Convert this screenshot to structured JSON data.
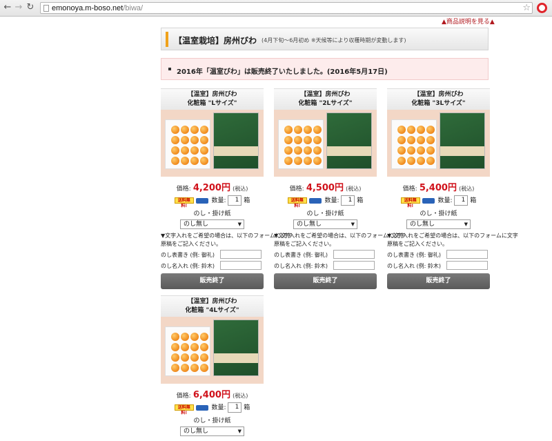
{
  "browser": {
    "url_host": "emonoya.m-boso.net",
    "url_path": "/biwa/"
  },
  "page": {
    "help_link": "▲商品説明を見る▲",
    "title": "【温室栽培】房州びわ",
    "subtitle": "(4月下旬〜6月初め ※天候等により収穫時期が変動します)",
    "notice": "2016年「温室びわ」は販売終了いたしました。(2016年5月17日)"
  },
  "common": {
    "price_label": "価格:",
    "tax_label": "(税込)",
    "free_shipping": "送料無料!",
    "qty_label": "数量:",
    "qty_value": "1",
    "qty_unit": "箱",
    "noshi_label": "のし・掛け紙",
    "noshi_selected": "のし無し",
    "help_text": "▼文字入れをご希望の場合は、以下のフォームに文字原稿をご記入ください。",
    "field1_label": "のし表書き (例: 御礼)",
    "field2_label": "のし名入れ (例: 鈴木)",
    "soldout_label": "販売終了"
  },
  "products": [
    {
      "line1": "【温室】房州びわ",
      "line2": "化粧箱 \"Lサイズ\"",
      "price": "4,200円"
    },
    {
      "line1": "【温室】房州びわ",
      "line2": "化粧箱 \"2Lサイズ\"",
      "price": "4,500円"
    },
    {
      "line1": "【温室】房州びわ",
      "line2": "化粧箱 \"3Lサイズ\"",
      "price": "5,400円"
    },
    {
      "line1": "【温室】房州びわ",
      "line2": "化粧箱 \"4Lサイズ\"",
      "price": "6,400円"
    }
  ]
}
